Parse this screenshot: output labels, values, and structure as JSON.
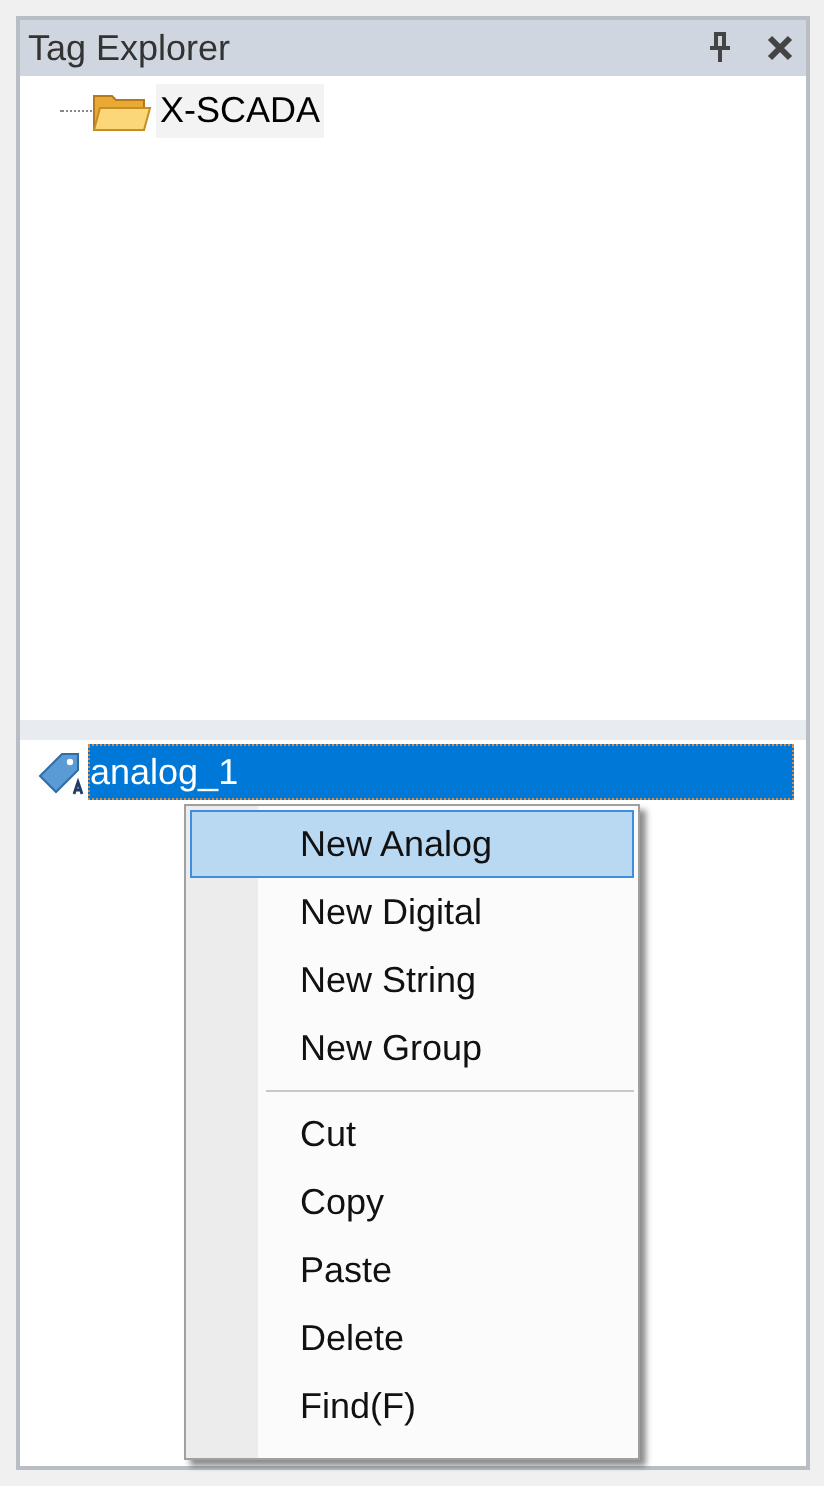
{
  "panel": {
    "title": "Tag Explorer"
  },
  "tree": [
    {
      "label": "X-SCADA",
      "selected": false
    }
  ],
  "tags": [
    {
      "label": "analog_1",
      "selected": true
    }
  ],
  "context_menu": [
    {
      "kind": "item",
      "label": "New Analog",
      "selected": true
    },
    {
      "kind": "item",
      "label": "New Digital",
      "selected": false
    },
    {
      "kind": "item",
      "label": "New String",
      "selected": false
    },
    {
      "kind": "item",
      "label": "New Group",
      "selected": false
    },
    {
      "kind": "separator"
    },
    {
      "kind": "item",
      "label": "Cut",
      "selected": false
    },
    {
      "kind": "item",
      "label": "Copy",
      "selected": false
    },
    {
      "kind": "item",
      "label": "Paste",
      "selected": false
    },
    {
      "kind": "item",
      "label": "Delete",
      "selected": false
    },
    {
      "kind": "item",
      "label": "Find(F)",
      "selected": false
    }
  ]
}
